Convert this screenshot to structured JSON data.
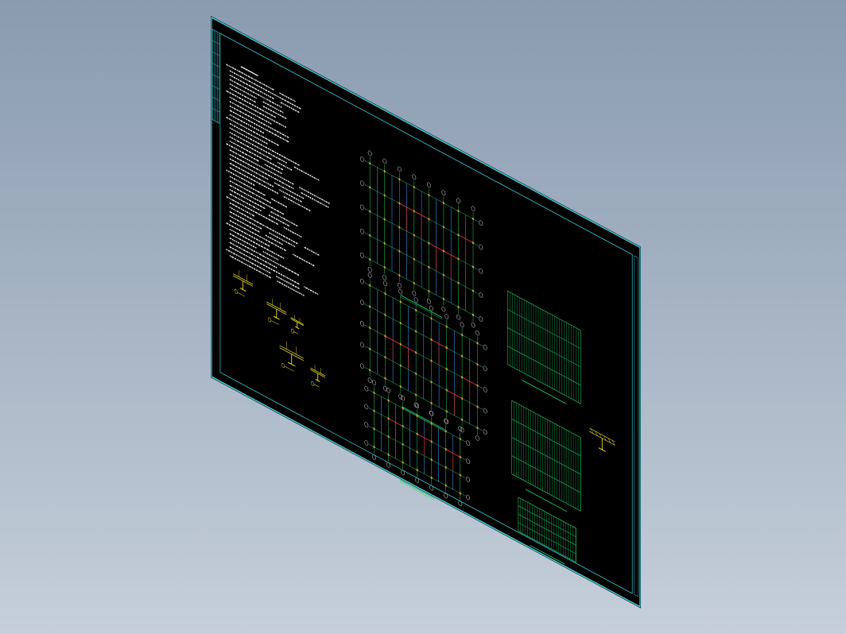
{
  "viewer": {
    "background_top": "#8a9bb0",
    "background_bottom": "#c6cfdb",
    "view": "isometric"
  },
  "sheet": {
    "background": "#000000",
    "border_color": "#3fd7e6",
    "notes_color": "#f2f2f2",
    "detail_color": "#f0e020",
    "plan_grid_color": "#22d36a",
    "column_color": "#3aa0ff",
    "beam_color": "#e03030",
    "highlight_color": "#e8a020",
    "axis_bubble_color": "#e8e8e8"
  },
  "plans": [
    {
      "id": "plan-1",
      "kind": "framing-plan"
    },
    {
      "id": "plan-2",
      "kind": "framing-plan"
    },
    {
      "id": "plan-3",
      "kind": "framing-plan"
    }
  ],
  "deck_layouts": [
    {
      "id": "deck-1",
      "kind": "deck-layout"
    },
    {
      "id": "deck-2",
      "kind": "deck-layout"
    },
    {
      "id": "deck-3",
      "kind": "deck-layout"
    }
  ],
  "details": [
    {
      "id": "detail-1"
    },
    {
      "id": "detail-2"
    },
    {
      "id": "detail-3"
    },
    {
      "id": "detail-4"
    },
    {
      "id": "detail-5"
    }
  ]
}
